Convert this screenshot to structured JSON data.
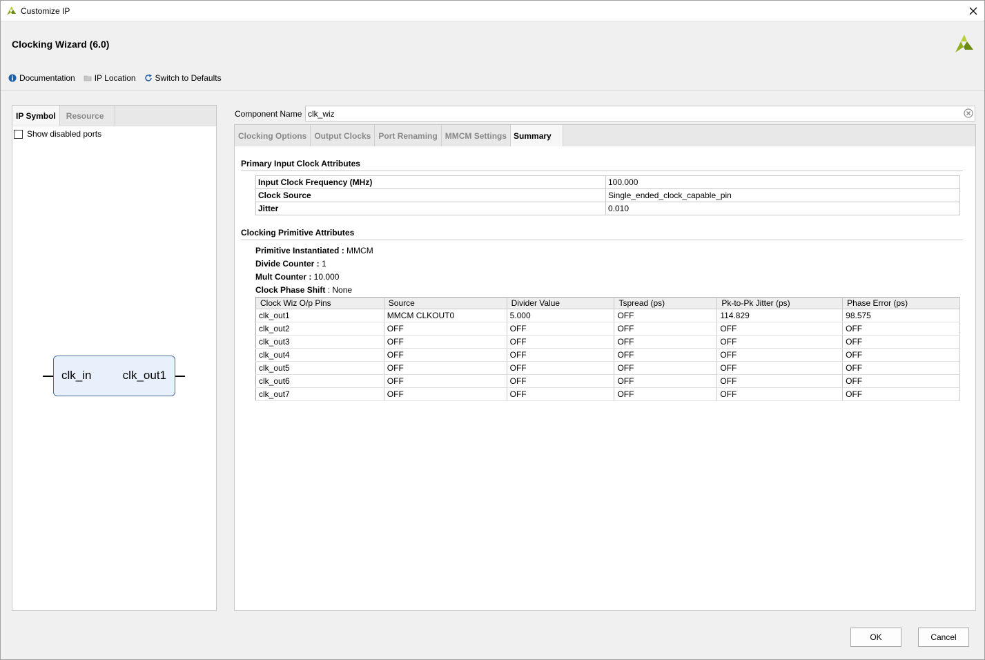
{
  "window": {
    "title": "Customize IP",
    "ip_title": "Clocking Wizard (6.0)"
  },
  "toolbar": {
    "documentation": "Documentation",
    "ip_location": "IP Location",
    "switch_defaults": "Switch to Defaults"
  },
  "left": {
    "tabs": [
      "IP Symbol",
      "Resource"
    ],
    "show_disabled": "Show disabled ports",
    "symbol": {
      "input_pin": "clk_in",
      "output_pin": "clk_out1"
    }
  },
  "component": {
    "label": "Component Name",
    "value": "clk_wiz"
  },
  "tabs": [
    "Clocking Options",
    "Output Clocks",
    "Port Renaming",
    "MMCM Settings",
    "Summary"
  ],
  "summary": {
    "primary_title": "Primary Input Clock Attributes",
    "primary_rows": [
      {
        "key": "Input Clock Frequency (MHz)",
        "value": "100.000"
      },
      {
        "key": "Clock Source",
        "value": "Single_ended_clock_capable_pin"
      },
      {
        "key": "Jitter",
        "value": "0.010"
      }
    ],
    "primitive_title": "Clocking Primitive Attributes",
    "primitive": [
      {
        "key": "Primitive Instantiated :",
        "value": " MMCM"
      },
      {
        "key": "Divide Counter :",
        "value": " 1"
      },
      {
        "key": "Mult Counter :",
        "value": " 10.000"
      },
      {
        "key": "Clock Phase Shift",
        "value": " : None"
      }
    ],
    "clock_headers": [
      "Clock Wiz O/p Pins",
      "Source",
      "Divider Value",
      "Tspread (ps)",
      "Pk-to-Pk Jitter (ps)",
      "Phase Error (ps)"
    ],
    "clock_rows": [
      [
        "clk_out1",
        "MMCM CLKOUT0",
        "5.000",
        "OFF",
        "114.829",
        "98.575"
      ],
      [
        "clk_out2",
        "OFF",
        "OFF",
        "OFF",
        "OFF",
        "OFF"
      ],
      [
        "clk_out3",
        "OFF",
        "OFF",
        "OFF",
        "OFF",
        "OFF"
      ],
      [
        "clk_out4",
        "OFF",
        "OFF",
        "OFF",
        "OFF",
        "OFF"
      ],
      [
        "clk_out5",
        "OFF",
        "OFF",
        "OFF",
        "OFF",
        "OFF"
      ],
      [
        "clk_out6",
        "OFF",
        "OFF",
        "OFF",
        "OFF",
        "OFF"
      ],
      [
        "clk_out7",
        "OFF",
        "OFF",
        "OFF",
        "OFF",
        "OFF"
      ]
    ]
  },
  "buttons": {
    "ok": "OK",
    "cancel": "Cancel"
  },
  "colors": {
    "logo": "#8fae1b",
    "info_icon": "#1f5fa8",
    "symbol_border": "#4a6b9c",
    "symbol_fill": "#e8f1fb"
  },
  "icons": {
    "app": "xilinx-logo-icon",
    "close": "close-icon",
    "info": "info-icon",
    "folder": "folder-icon",
    "refresh": "refresh-icon",
    "clear": "clear-icon"
  }
}
